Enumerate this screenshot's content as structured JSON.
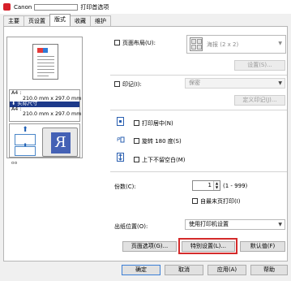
{
  "window": {
    "title_prefix": "Canon",
    "title_suffix": "打印首选项"
  },
  "tabs": [
    {
      "label": "主要",
      "active": false
    },
    {
      "label": "页设置",
      "active": false
    },
    {
      "label": "版式",
      "active": true
    },
    {
      "label": "收藏",
      "active": false
    },
    {
      "label": "维护",
      "active": false
    }
  ],
  "preview": {
    "paper_line1": "A4 :",
    "paper_line2": "210.0 mm x 297.0 mm",
    "scale_line": "实际尺寸",
    "paper_line3": "A4 :",
    "paper_line4": "210.0 mm x 297.0 mm",
    "roll_letter": "R",
    "bottom_glyph": "ᵒᵒ"
  },
  "page_layout": {
    "checkbox_label": "页面布局(U):",
    "checked": false,
    "select_value": "海报 (2 x 2)",
    "settings_button": "设置(S)..."
  },
  "stamp": {
    "checkbox_label": "印记(I):",
    "checked": false,
    "select_value": "保密",
    "define_button": "定义印记(J)..."
  },
  "options": [
    {
      "label": "打印居中(N)",
      "icon": "center-page-icon",
      "checked": false
    },
    {
      "label": "旋转 180 度(S)",
      "icon": "rotate-180-icon",
      "checked": false
    },
    {
      "label": "上下不留空白(M)",
      "icon": "no-margin-icon",
      "checked": false
    }
  ],
  "copies": {
    "label": "份数(C):",
    "value": "1",
    "range": "(1 - 999)",
    "reverse_label": "自最末页打印(I)",
    "reverse_checked": false
  },
  "output": {
    "label": "出纸位置(O):",
    "select_value": "使用打印机设置"
  },
  "action_buttons": {
    "page_options": "页面选项(G)...",
    "special_settings": "特别设置(L)...",
    "defaults": "默认值(F)"
  },
  "footer": {
    "ok": "确定",
    "cancel": "取消",
    "apply": "应用(A)",
    "help": "帮助"
  },
  "colors": {
    "highlight": "#d42b2b",
    "selection_blue": "#1d3a8a",
    "preview_blue": "#4461b5"
  }
}
